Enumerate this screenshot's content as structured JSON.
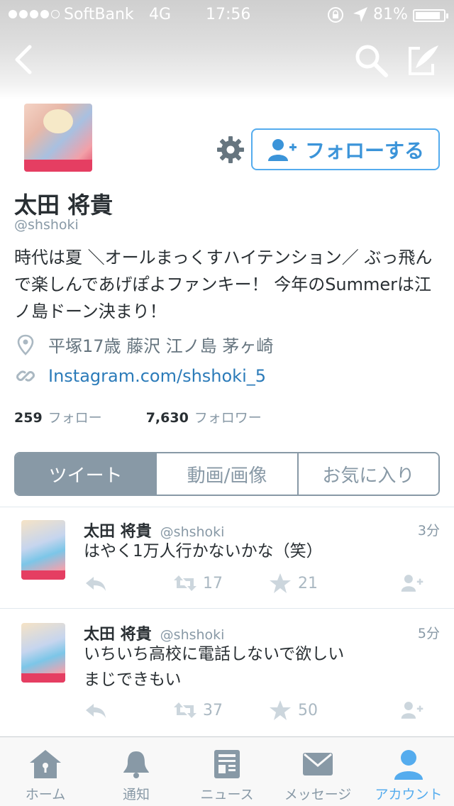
{
  "status_bar": {
    "carrier": "SoftBank",
    "network": "4G",
    "time": "17:56",
    "battery": "81%",
    "battery_level": 0.81
  },
  "nav": {
    "back_icon": "chevron-left-icon",
    "search_icon": "search-icon",
    "compose_icon": "compose-icon"
  },
  "profile": {
    "name": "太田 将貴",
    "handle": "@shshoki",
    "follow_label": "フォローする",
    "bio": "時代は夏 ＼オールまっくすハイテンション／ ぶっ飛んで楽しんであげぽよファンキー！ 今年のSummerは江ノ島ドーン決まり！",
    "location": "平塚17歳 藤沢 江ノ島 茅ヶ崎",
    "link": "Instagram.com/shshoki_5",
    "following_count": "259",
    "following_label": "フォロー",
    "followers_count": "7,630",
    "followers_label": "フォロワー"
  },
  "tabs": [
    {
      "label": "ツイート",
      "active": true
    },
    {
      "label": "動画/画像",
      "active": false
    },
    {
      "label": "お気に入り",
      "active": false
    }
  ],
  "tweets": [
    {
      "name": "太田 将貴",
      "handle": "@shshoki",
      "time": "3分",
      "text": "はやく1万人行かないかな（笑）",
      "retweets": "17",
      "favorites": "21"
    },
    {
      "name": "太田 将貴",
      "handle": "@shshoki",
      "time": "5分",
      "text": "いちいち高校に電話しないで欲しい\nまじできもい",
      "retweets": "37",
      "favorites": "50"
    }
  ],
  "tabbar": [
    {
      "label": "ホーム",
      "icon": "home-icon"
    },
    {
      "label": "通知",
      "icon": "bell-icon"
    },
    {
      "label": "ニュース",
      "icon": "news-icon"
    },
    {
      "label": "メッセージ",
      "icon": "envelope-icon"
    },
    {
      "label": "アカウント",
      "icon": "person-icon",
      "active": true
    }
  ],
  "colors": {
    "accent": "#55acee",
    "link": "#2b7bb9",
    "muted": "#8899a6"
  }
}
